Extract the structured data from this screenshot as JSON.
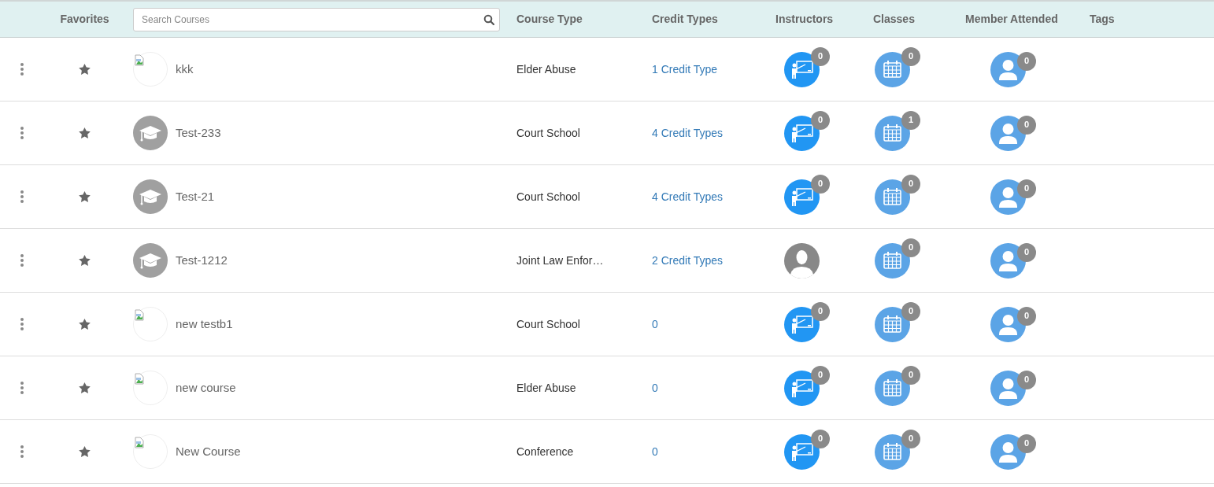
{
  "header": {
    "columns": [
      "Favorites",
      "Course Type",
      "Credit Types",
      "Instructors",
      "Classes",
      "Member Attended",
      "Tags"
    ],
    "search": {
      "placeholder": "Search Courses"
    }
  },
  "rows": [
    {
      "thumbnail": {
        "kind": "broken"
      },
      "name": "kkk",
      "course_type": "Elder Abuse",
      "credit_types": "1 Credit Type",
      "instructors": {
        "kind": "instructor",
        "count": "0"
      },
      "classes": "0",
      "members": "0"
    },
    {
      "thumbnail": {
        "kind": "cap"
      },
      "name": "Test-233",
      "course_type": "Court School",
      "credit_types": "4 Credit Types",
      "instructors": {
        "kind": "instructor",
        "count": "0"
      },
      "classes": "1",
      "members": "0"
    },
    {
      "thumbnail": {
        "kind": "cap"
      },
      "name": "Test-21",
      "course_type": "Court School",
      "credit_types": "4 Credit Types",
      "instructors": {
        "kind": "instructor",
        "count": "0"
      },
      "classes": "0",
      "members": "0"
    },
    {
      "thumbnail": {
        "kind": "cap"
      },
      "name": "Test-1212",
      "course_type": "Joint Law Enfor…",
      "credit_types": "2 Credit Types",
      "instructors": {
        "kind": "avatar"
      },
      "classes": "0",
      "members": "0"
    },
    {
      "thumbnail": {
        "kind": "broken"
      },
      "name": "new testb1",
      "course_type": "Court School",
      "credit_types": "0",
      "instructors": {
        "kind": "instructor",
        "count": "0"
      },
      "classes": "0",
      "members": "0"
    },
    {
      "thumbnail": {
        "kind": "broken"
      },
      "name": "new course",
      "course_type": "Elder Abuse",
      "credit_types": "0",
      "instructors": {
        "kind": "instructor",
        "count": "0"
      },
      "classes": "0",
      "members": "0"
    },
    {
      "thumbnail": {
        "kind": "broken"
      },
      "name": "New Course",
      "course_type": "Conference",
      "credit_types": "0",
      "instructors": {
        "kind": "instructor",
        "count": "0"
      },
      "classes": "0",
      "members": "0"
    }
  ]
}
